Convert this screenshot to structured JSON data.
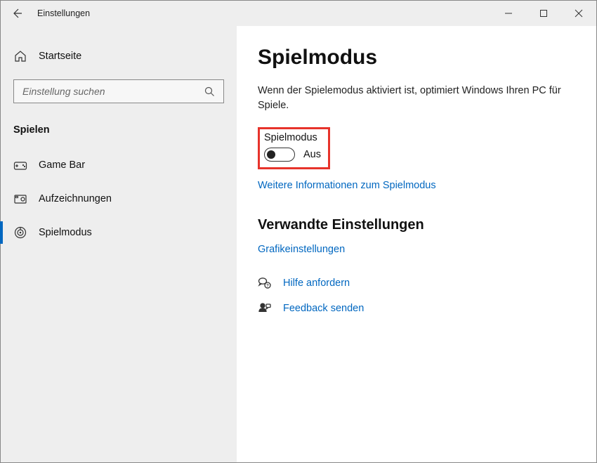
{
  "app": {
    "title": "Einstellungen"
  },
  "sidebar": {
    "home_label": "Startseite",
    "search_placeholder": "Einstellung suchen",
    "category": "Spielen",
    "items": [
      {
        "label": "Game Bar",
        "icon": "gamebar",
        "selected": false
      },
      {
        "label": "Aufzeichnungen",
        "icon": "capture",
        "selected": false
      },
      {
        "label": "Spielmodus",
        "icon": "gamemode",
        "selected": true
      }
    ]
  },
  "main": {
    "heading": "Spielmodus",
    "description": "Wenn der Spielemodus aktiviert ist, optimiert Windows Ihren PC für Spiele.",
    "toggle": {
      "label": "Spielmodus",
      "state_text": "Aus",
      "on": false
    },
    "more_info_link": "Weitere Informationen zum Spielmodus",
    "related": {
      "heading": "Verwandte Einstellungen",
      "links": [
        "Grafikeinstellungen"
      ]
    },
    "actions": [
      {
        "label": "Hilfe anfordern",
        "icon": "help"
      },
      {
        "label": "Feedback senden",
        "icon": "feedback"
      }
    ]
  }
}
